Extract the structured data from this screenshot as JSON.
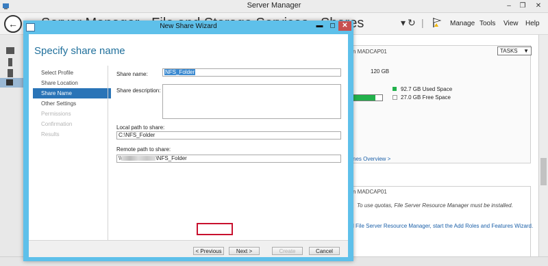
{
  "window": {
    "title": "Server Manager"
  },
  "header": {
    "breadcrumb": "Server Manager › File and Storage Services › Shares",
    "menu": [
      "Manage",
      "Tools",
      "View",
      "Help"
    ]
  },
  "background": {
    "tile1_header": "n MADCAP01",
    "tasks_label": "TASKS",
    "capacity": "120 GB",
    "used_space": "92.7 GB Used Space",
    "free_space": "27.0 GB Free Space",
    "used_fraction": 0.77,
    "overview_link": "nes Overview >",
    "tile2_header": "n MADCAP01",
    "quota_note": "To use quotas, File Server Resource Manager must be installed.",
    "install_link": "l File Server Resource Manager, start the Add Roles and Features Wizard.",
    "colors": {
      "used": "#22b14c",
      "free": "#ffffff"
    }
  },
  "wizard": {
    "title": "New Share Wizard",
    "heading": "Specify share name",
    "steps": [
      {
        "label": "Select Profile",
        "state": "normal"
      },
      {
        "label": "Share Location",
        "state": "normal"
      },
      {
        "label": "Share Name",
        "state": "active"
      },
      {
        "label": "Other Settings",
        "state": "normal"
      },
      {
        "label": "Permissions",
        "state": "disabled"
      },
      {
        "label": "Confirmation",
        "state": "disabled"
      },
      {
        "label": "Results",
        "state": "disabled"
      }
    ],
    "share_name_label": "Share name:",
    "share_name_value": "NFS_Folder",
    "share_description_label": "Share description:",
    "share_description_value": "",
    "local_path_label": "Local path to share:",
    "local_path_value": "C:\\NFS_Folder",
    "remote_path_label": "Remote path to share:",
    "remote_path_prefix": "\\\\",
    "remote_path_suffix": "\\NFS_Folder",
    "buttons": {
      "previous": "< Previous",
      "next": "Next >",
      "create": "Create",
      "cancel": "Cancel"
    },
    "accent_color": "#2a74b7"
  }
}
